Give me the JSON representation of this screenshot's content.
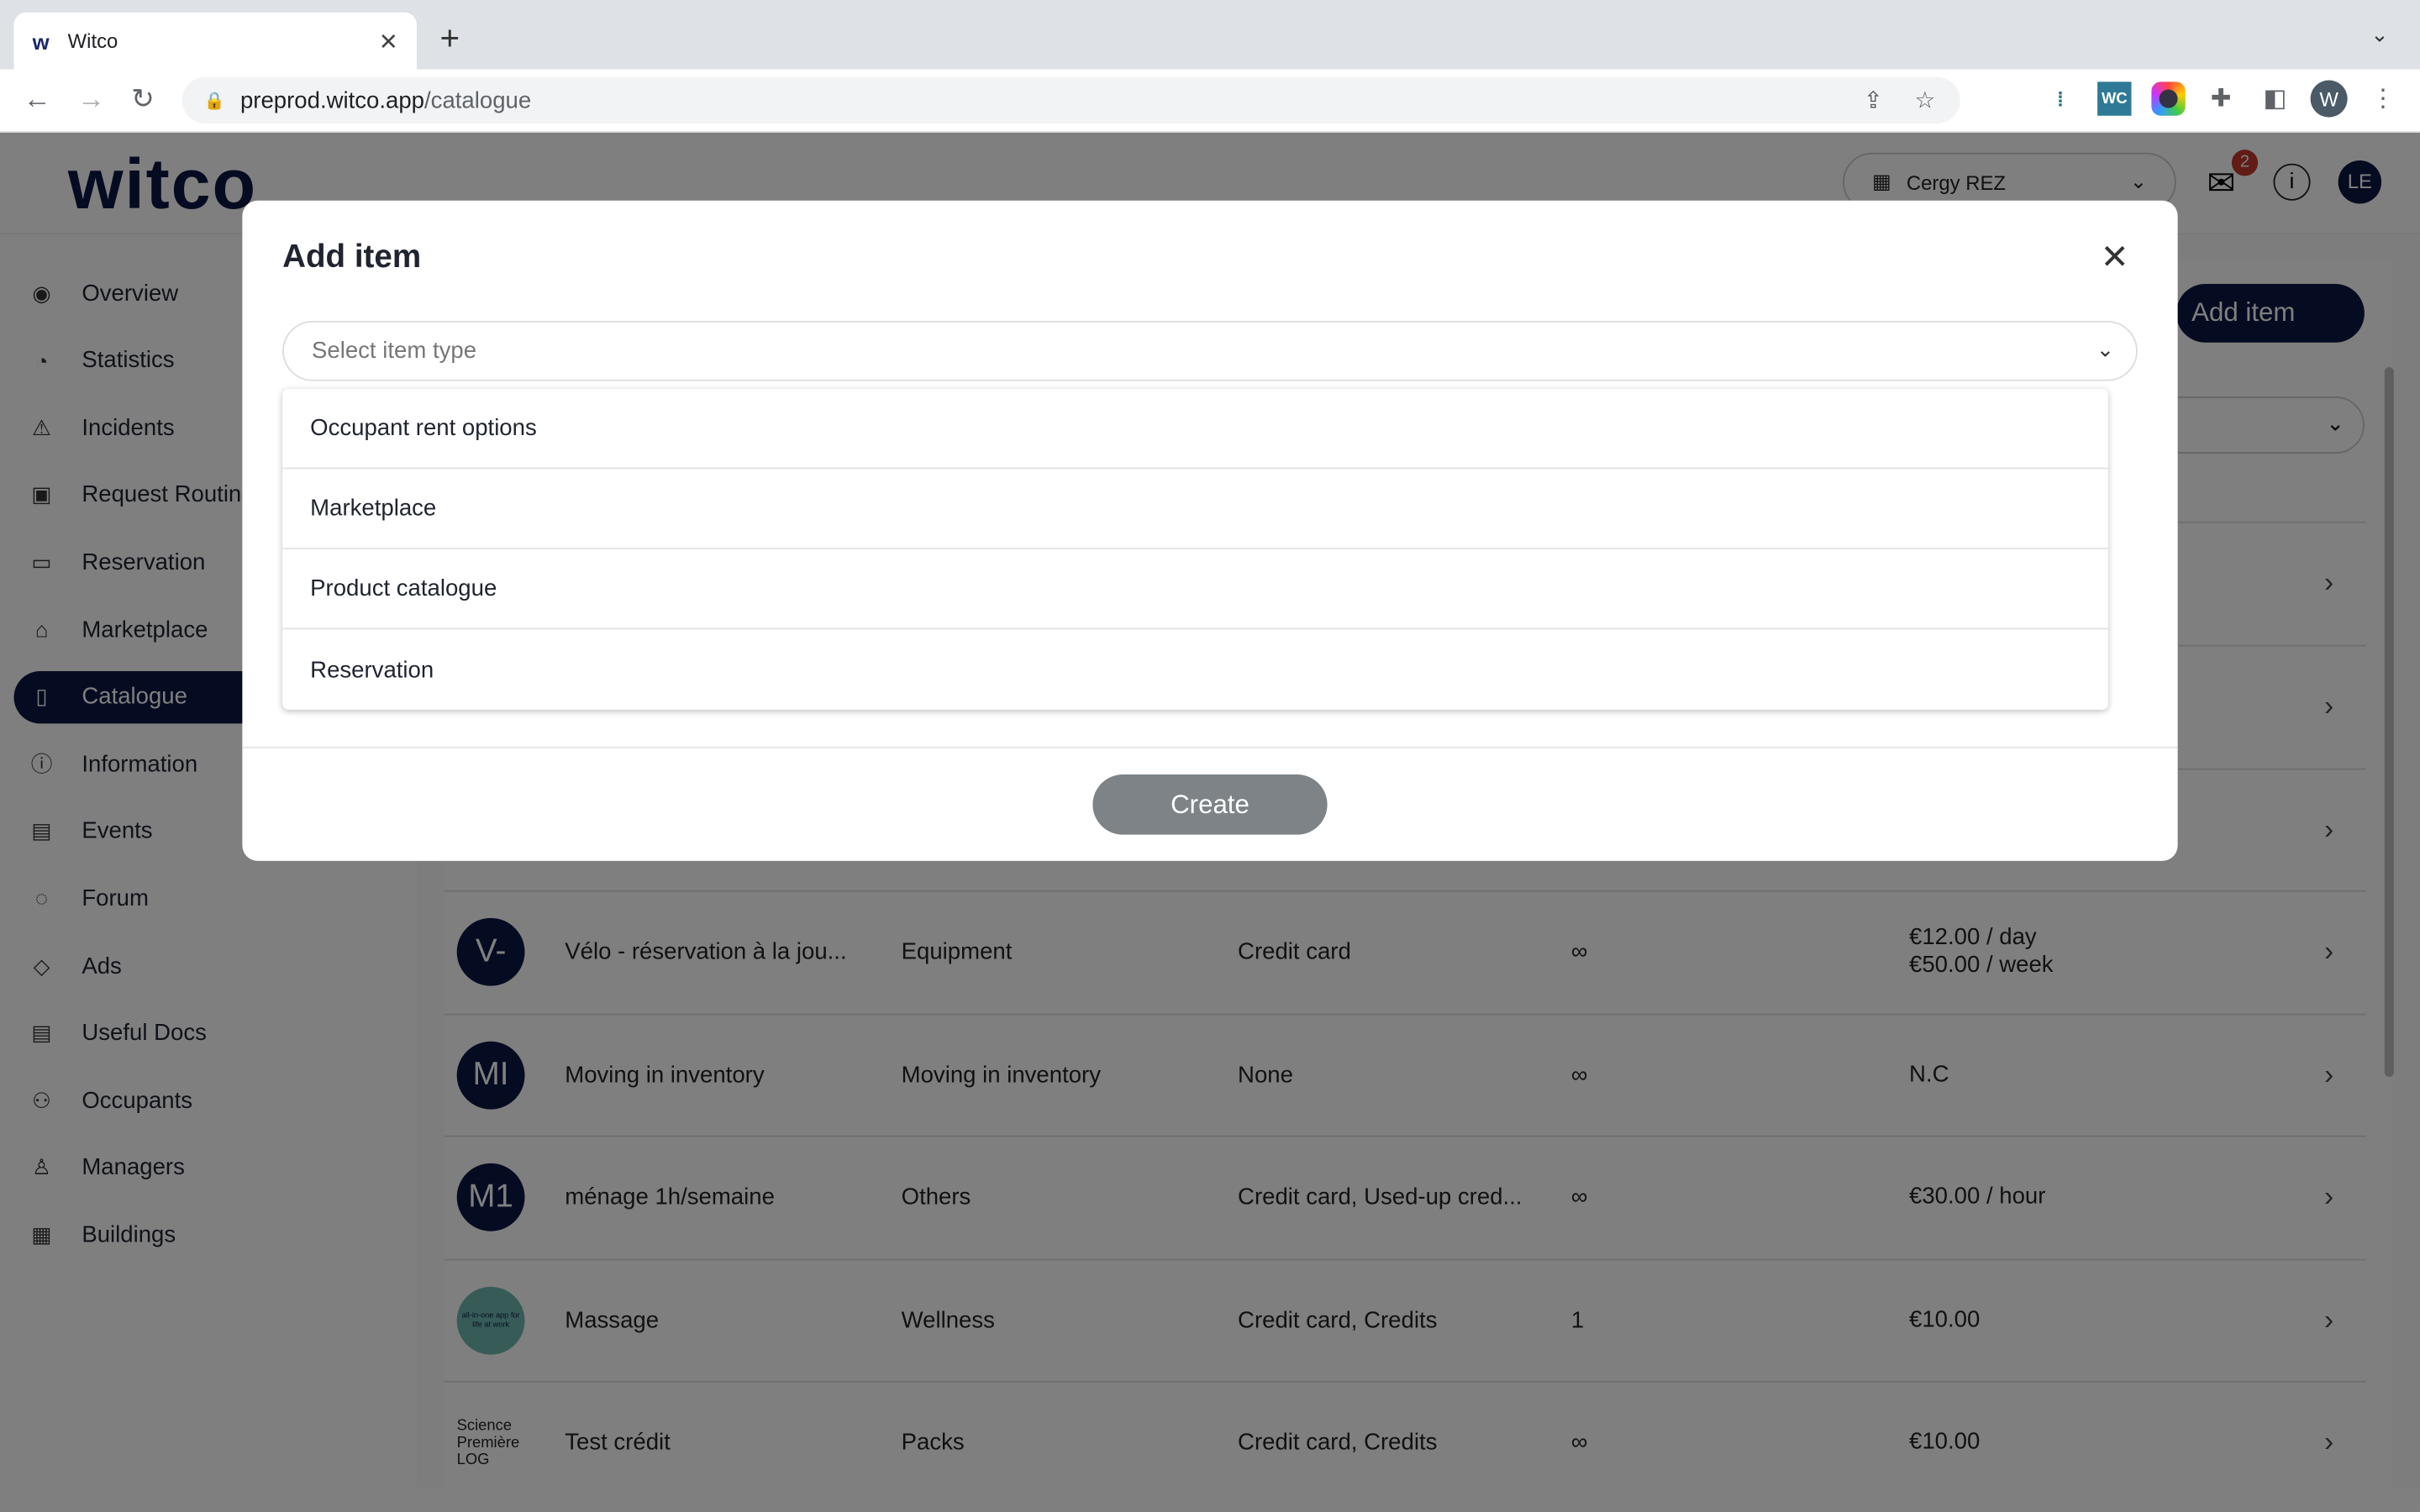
{
  "browser": {
    "tab_title": "Witco",
    "url_host": "preprod.witco.app",
    "url_path": "/catalogue",
    "profile_initial": "W",
    "ext_wc": "WC"
  },
  "header": {
    "logo": "witco",
    "site": "Cergy REZ",
    "notifications": "2",
    "user_initials": "LE"
  },
  "sidebar": {
    "items": [
      {
        "label": "Overview",
        "icon": "eye-icon"
      },
      {
        "label": "Statistics",
        "icon": "pie-chart-icon"
      },
      {
        "label": "Incidents",
        "icon": "warning-icon"
      },
      {
        "label": "Request Routing",
        "icon": "contact-icon"
      },
      {
        "label": "Reservation",
        "icon": "calendar-icon"
      },
      {
        "label": "Marketplace",
        "icon": "store-icon"
      },
      {
        "label": "Catalogue",
        "icon": "book-icon",
        "active": true
      },
      {
        "label": "Information",
        "icon": "info-icon"
      },
      {
        "label": "Events",
        "icon": "calendar-event-icon"
      },
      {
        "label": "Forum",
        "icon": "chat-icon"
      },
      {
        "label": "Ads",
        "icon": "tag-icon"
      },
      {
        "label": "Useful Docs",
        "icon": "document-icon"
      },
      {
        "label": "Occupants",
        "icon": "users-icon"
      },
      {
        "label": "Managers",
        "icon": "user-icon"
      },
      {
        "label": "Buildings",
        "icon": "building-icon"
      }
    ]
  },
  "main": {
    "add_item_label": "Add item",
    "rows": [
      {
        "avatar": "V-",
        "name": "Vélo - réservation à la jou...",
        "type": "Equipment",
        "payment": "Credit card",
        "stock": "∞",
        "price": "€12.00 / day",
        "price2": "€50.00 / week"
      },
      {
        "avatar": "MI",
        "name": "Moving in inventory",
        "type": "Moving in inventory",
        "payment": "None",
        "stock": "∞",
        "price": "N.C"
      },
      {
        "avatar": "M1",
        "name": "ménage 1h/semaine",
        "type": "Others",
        "payment": "Credit card, Used-up cred...",
        "stock": "∞",
        "price": "€30.00 / hour"
      },
      {
        "avatar": "all-in-one app for life at work",
        "name": "Massage",
        "type": "Wellness",
        "payment": "Credit card, Credits",
        "stock": "1",
        "price": "€10.00"
      },
      {
        "avatar": "Science Première LOG",
        "name": "Test crédit",
        "type": "Packs",
        "payment": "Credit card, Credits",
        "stock": "∞",
        "price": "€10.00"
      }
    ]
  },
  "modal": {
    "title": "Add item",
    "select_placeholder": "Select item type",
    "options": [
      "Occupant rent options",
      "Marketplace",
      "Product catalogue",
      "Reservation"
    ],
    "create_label": "Create"
  },
  "colors": {
    "brand": "#0b1742",
    "create_disabled": "#7d8387",
    "badge": "#c0392b"
  }
}
